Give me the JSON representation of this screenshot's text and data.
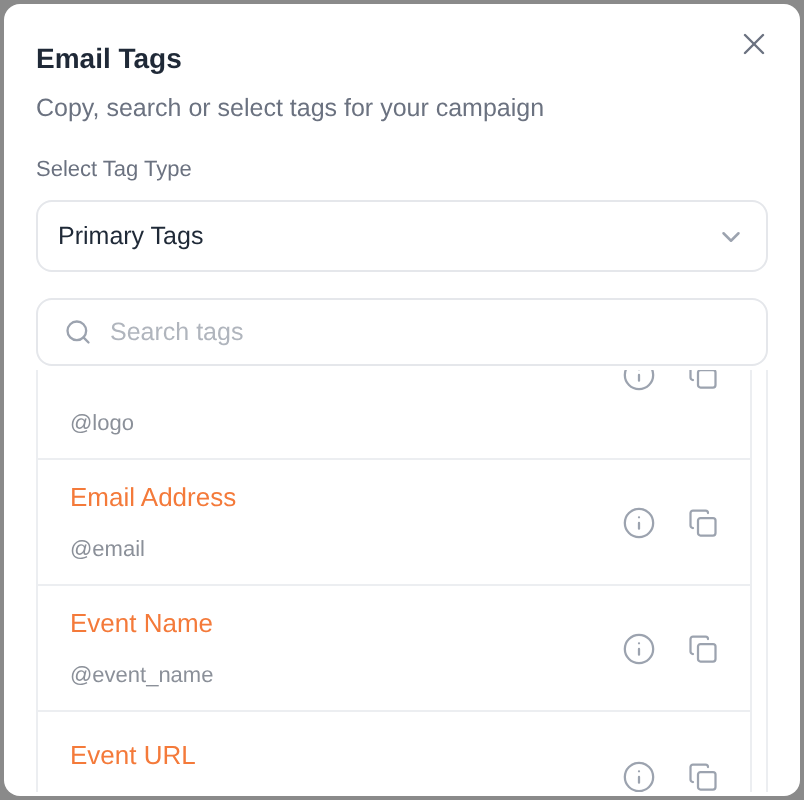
{
  "dialog": {
    "title": "Email Tags",
    "subtitle": "Copy, search or select tags for your campaign"
  },
  "tag_type": {
    "label": "Select Tag Type",
    "value": "Primary Tags"
  },
  "search": {
    "placeholder": "Search tags"
  },
  "tags": [
    {
      "tag": "@logo"
    },
    {
      "name": "Email Address",
      "tag": "@email"
    },
    {
      "name": "Event Name",
      "tag": "@event_name"
    },
    {
      "name": "Event URL"
    }
  ]
}
